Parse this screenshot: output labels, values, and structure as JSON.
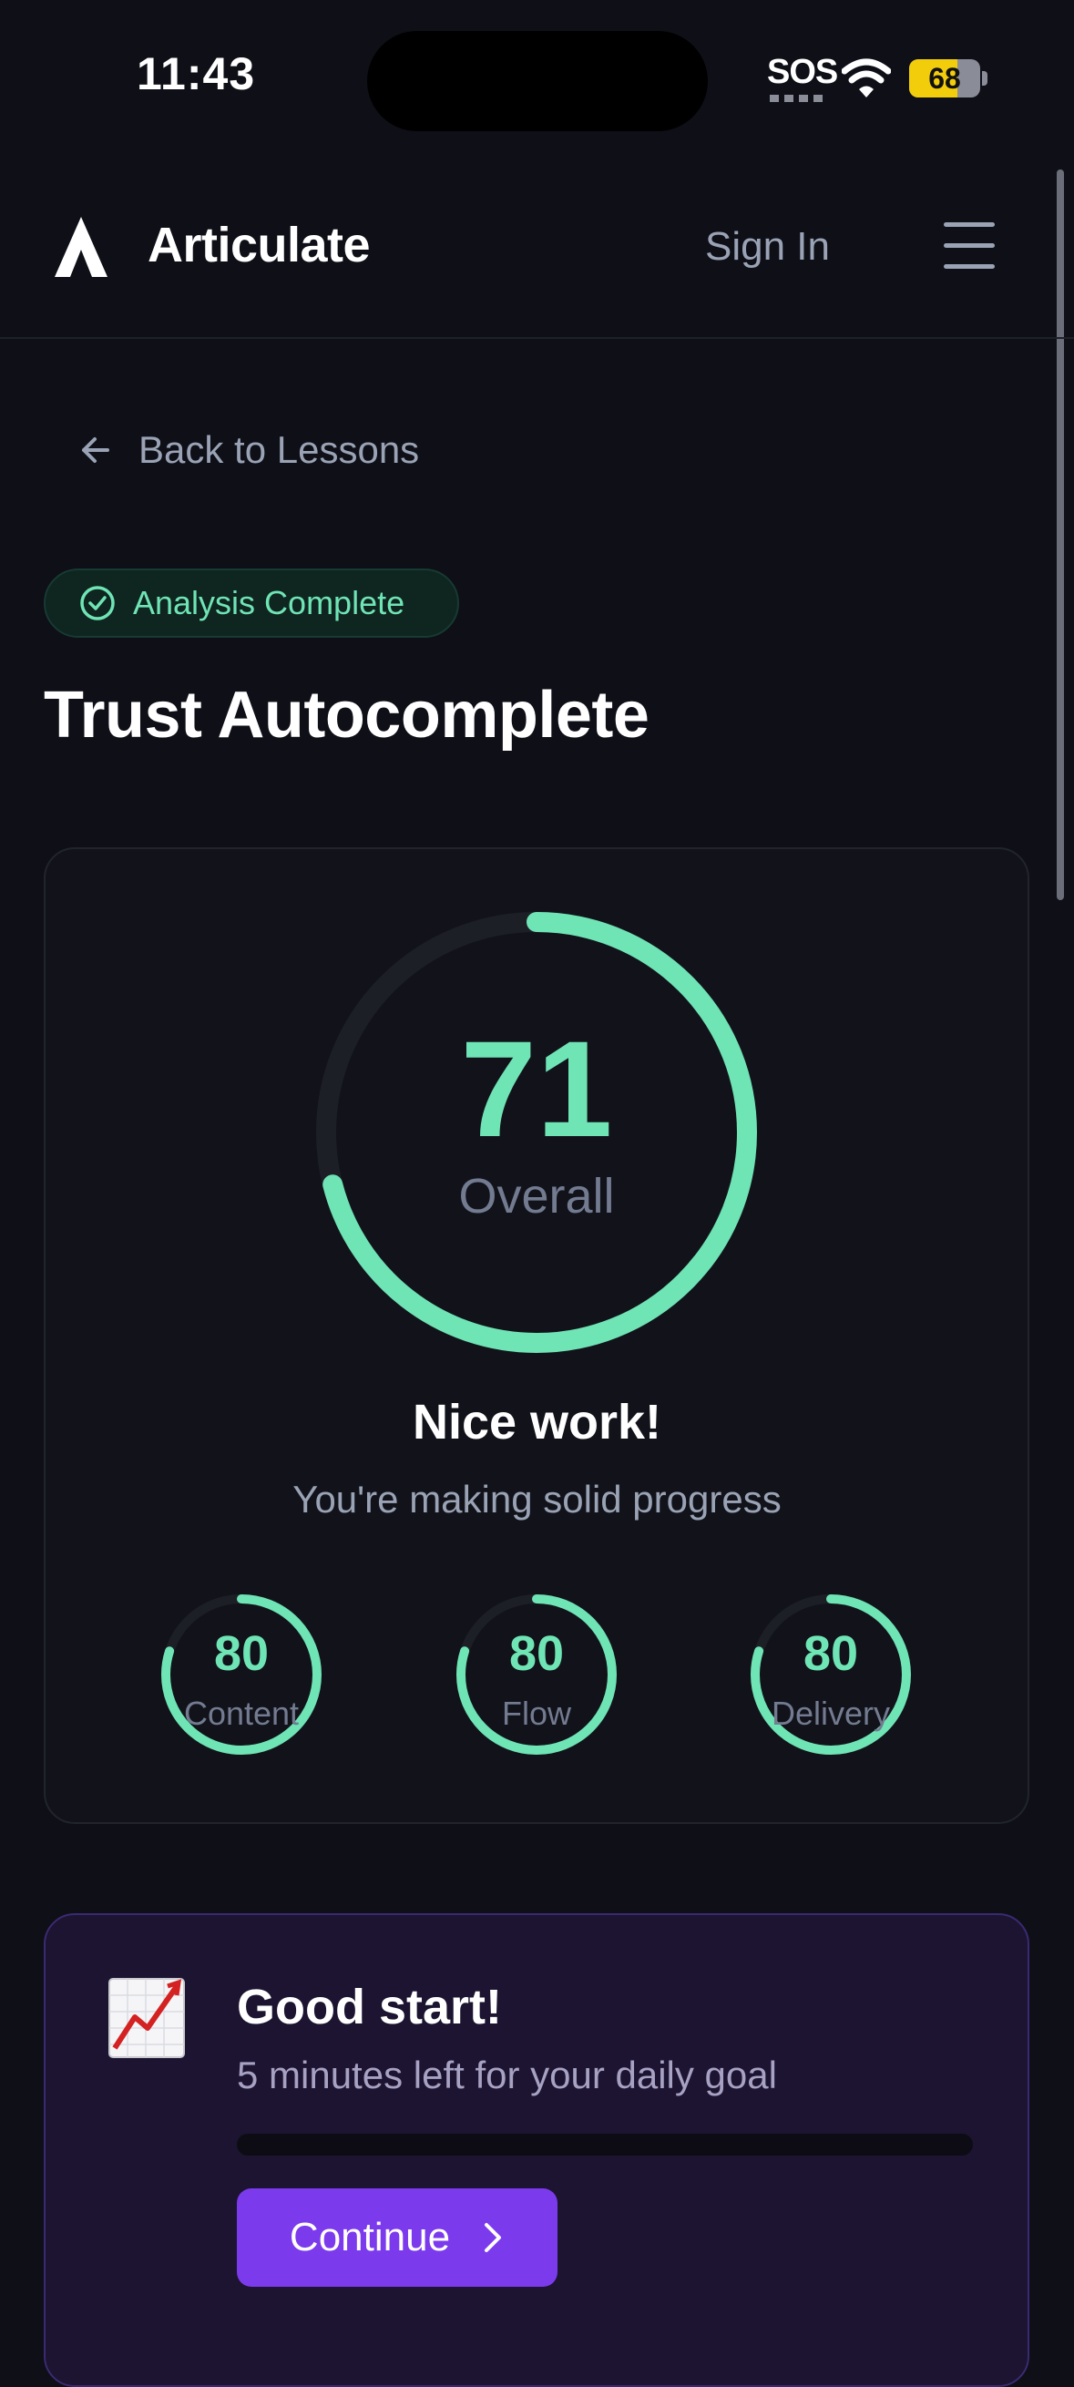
{
  "status_bar": {
    "time": "11:43",
    "sos": "SOS",
    "battery": "68",
    "battery_level": 0.68
  },
  "nav": {
    "brand": "Articulate",
    "sign_in": "Sign In"
  },
  "back_link": "Back to Lessons",
  "badge": "Analysis Complete",
  "title": "Trust Autocomplete",
  "overall": {
    "score": "71",
    "label": "Overall",
    "progress": 0.71
  },
  "feedback": {
    "title": "Nice work!",
    "subtitle": "You're making solid progress"
  },
  "subscores": [
    {
      "value": "80",
      "label": "Content",
      "progress": 0.8
    },
    {
      "value": "80",
      "label": "Flow",
      "progress": 0.8
    },
    {
      "value": "80",
      "label": "Delivery",
      "progress": 0.8
    }
  ],
  "goal": {
    "title": "Good start!",
    "subtitle": "5 minutes left for your daily goal",
    "progress": 0,
    "button": "Continue"
  },
  "colors": {
    "accent_green": "#6fe4b5",
    "accent_purple": "#7c3aed",
    "background": "#0e0f17"
  }
}
